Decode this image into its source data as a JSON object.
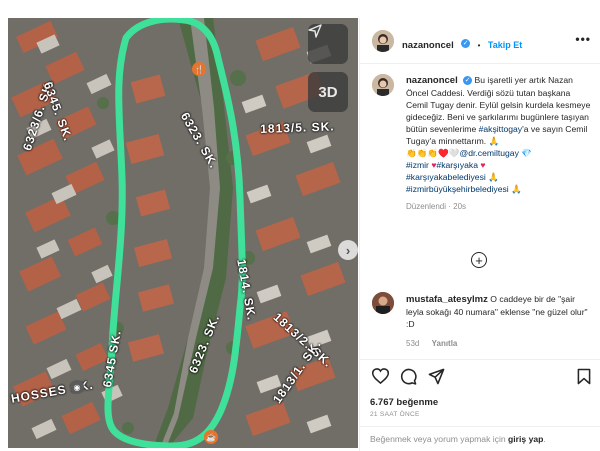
{
  "map": {
    "street_labels": [
      "6323. SK.",
      "6323. SK.",
      "6323/6. SK.",
      "6345. SK.",
      "1813/5. SK.",
      "1814. SK.",
      "1813/2. SK.",
      "1813/1. SK.",
      "HOSSES SK.",
      "6345 SK."
    ],
    "buttons": {
      "locate": "locate-arrow",
      "threed": "3D"
    },
    "highlight_color": "#3ee09a"
  },
  "post": {
    "username": "nazanoncel",
    "verified_icon": "verified-badge",
    "separator": "•",
    "follow_label": "Takip Et",
    "more_label": "•••",
    "caption_user": "nazanoncel",
    "caption_body": "Bu işaretli yer artık Nazan Öncel Caddesi. Verdiği sözü tutan başkana Cemil Tugay denir. Eylül gelsin kurdela kesmeye gideceğiz. Beni ve şarkılarımı bugünlere taşıyan bütün sevenlerime",
    "caption_mention1": "#akşittogay",
    "caption_body2": "'a ve sayın Cemil Tugay'a minnettarım. 🙏",
    "caption_hearts": "👏👏👏♥️🤍",
    "caption_mention2": "@dr.cemiltugay",
    "caption_gem": "💎",
    "hashtag1": "#izmir",
    "hashtag2": "#karşıyaka",
    "hashtag3": "#karşıyakabelediyesi",
    "hashtag4": "#izmirbüyükşehirbelediyesi",
    "heart": "♥",
    "pray": "🙏",
    "edited_label": "Düzenlendi",
    "edited_time": "20s",
    "load_more": "+",
    "comment_user": "mustafa_atesylmz",
    "comment_text": "O caddeye bir de \"şair leyla sokağı 40 numara\" eklense \"ne güzel olur\" :D",
    "comment_time": "53d",
    "reply_label": "Yanıtla",
    "likes": "6.767 beğenme",
    "time_ago": "21 SAAT ÖNCE",
    "login_prefix": "Beğenmek veya yorum yapmak için",
    "login_link": "giriş yap",
    "login_suffix": "."
  },
  "colors": {
    "accent": "#0095f6",
    "text": "#262626",
    "muted": "#8e8e8e",
    "highlight": "#3ee09a"
  }
}
